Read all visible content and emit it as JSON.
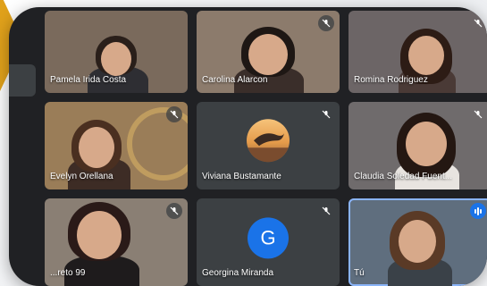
{
  "participants": [
    {
      "name": "Pamela Irida Costa",
      "muted": false,
      "type": "camera"
    },
    {
      "name": "Carolina Alarcon",
      "muted": true,
      "type": "camera"
    },
    {
      "name": "Romina Rodriguez",
      "muted": true,
      "type": "camera"
    },
    {
      "name": "Evelyn Orellana",
      "muted": true,
      "type": "camera"
    },
    {
      "name": "Viviana Bustamante",
      "muted": true,
      "type": "avatar-image"
    },
    {
      "name": "Claudia Soledad Fuent...",
      "muted": true,
      "type": "camera"
    },
    {
      "name": "...reto 99",
      "muted": true,
      "type": "camera"
    },
    {
      "name": "Georgina Miranda",
      "muted": true,
      "type": "avatar-letter",
      "initial": "G"
    },
    {
      "name": "Tú",
      "muted": false,
      "speaking": true,
      "type": "camera"
    }
  ],
  "colors": {
    "background": "#202124",
    "tile": "#3c4043",
    "accent": "#1a73e8",
    "decor": "#e0a11b"
  },
  "icons": {
    "muted": "mic-off-icon",
    "speaking": "audio-level-icon"
  }
}
